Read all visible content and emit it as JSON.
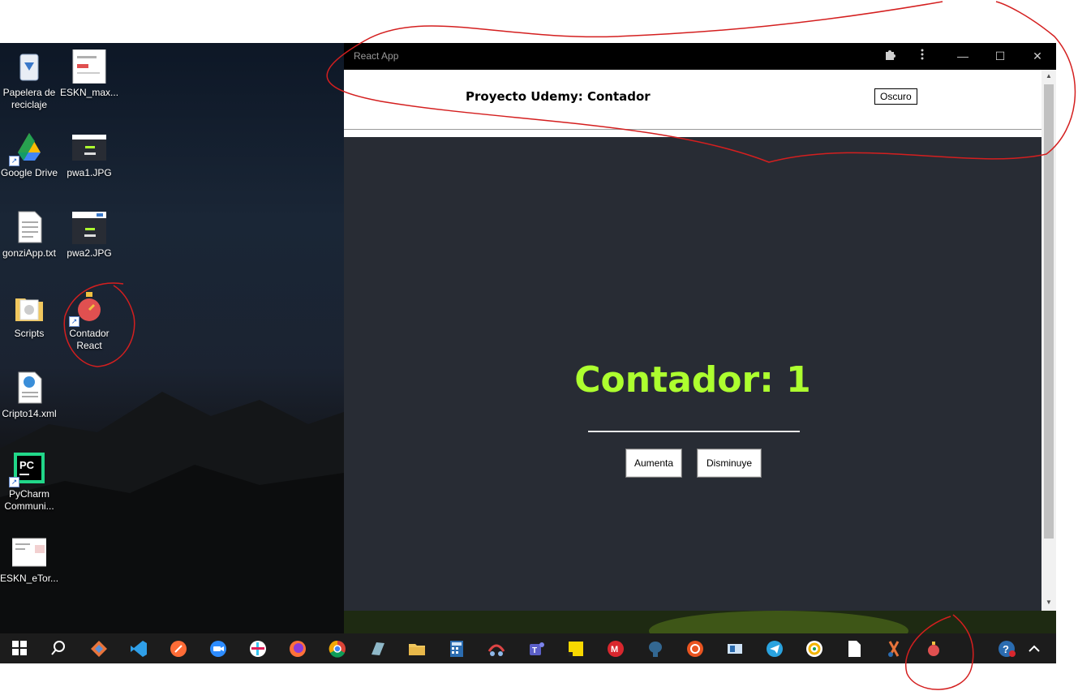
{
  "desktop": {
    "icons": [
      {
        "name": "recycle-bin-icon",
        "label": "Papelera de reciclaje"
      },
      {
        "name": "eskn-max-icon",
        "label": "ESKN_max..."
      },
      {
        "name": "google-drive-icon",
        "label": "Google Drive"
      },
      {
        "name": "pwa1-icon",
        "label": "pwa1.JPG"
      },
      {
        "name": "gonziapp-icon",
        "label": "gonziApp.txt"
      },
      {
        "name": "pwa2-icon",
        "label": "pwa2.JPG"
      },
      {
        "name": "scripts-folder-icon",
        "label": "Scripts"
      },
      {
        "name": "contador-react-icon",
        "label": "Contador React"
      },
      {
        "name": "cripto14-icon",
        "label": "Cripto14.xml"
      },
      {
        "name": "pycharm-icon",
        "label": "PyCharm Communi..."
      },
      {
        "name": "eskn-etor-icon",
        "label": "ESKN_eTor..."
      }
    ]
  },
  "window": {
    "title": "React App",
    "controls": {
      "extensions": "puzzle-icon",
      "menu": "more-vert-icon",
      "minimize": "—",
      "maximize": "☐",
      "close": "✕"
    }
  },
  "app": {
    "header_title": "Proyecto Udemy: Contador",
    "theme_button": "Oscuro",
    "counter_text": "Contador: 1",
    "increase_button": "Aumenta",
    "decrease_button": "Disminuye",
    "counter_color": "#adff2f",
    "background": "#282c34"
  },
  "taskbar": {
    "items": [
      "start-icon",
      "search-icon",
      "git-icon",
      "vscode-icon",
      "postman-icon",
      "zoom-icon",
      "slack-icon",
      "firefox-icon",
      "chrome-icon",
      "app-icon",
      "file-explorer-icon",
      "calculator-icon",
      "snipping-icon",
      "teams-icon",
      "sticky-notes-icon",
      "mega-icon",
      "postgres-icon",
      "ubuntu-icon",
      "news-icon",
      "telegram-icon",
      "app2-icon",
      "notepad-icon",
      "snip-sketch-icon",
      "contador-react-icon"
    ],
    "tray": [
      "help-icon",
      "chevron-up-icon"
    ]
  }
}
